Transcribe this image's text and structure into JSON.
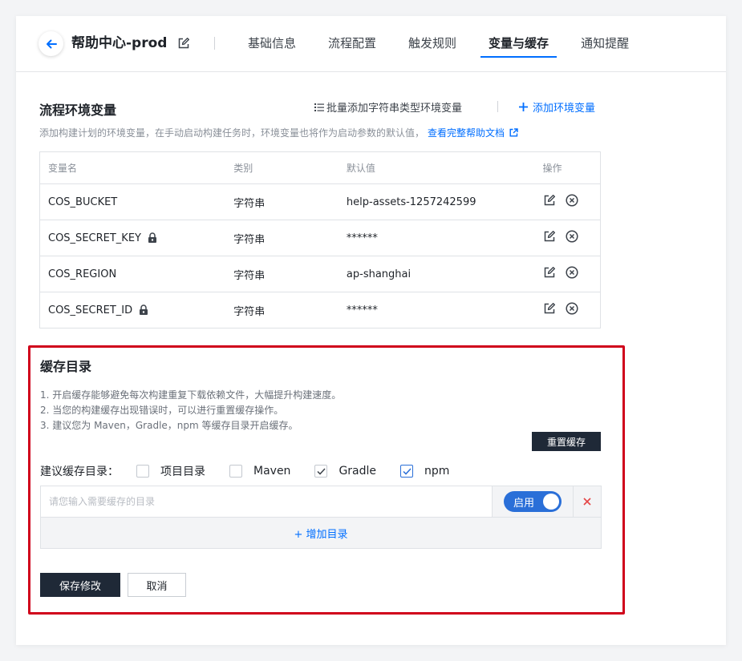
{
  "header": {
    "title": "帮助中心-prod",
    "tabs": [
      {
        "label": "基础信息",
        "active": false
      },
      {
        "label": "流程配置",
        "active": false
      },
      {
        "label": "触发规则",
        "active": false
      },
      {
        "label": "变量与缓存",
        "active": true
      },
      {
        "label": "通知提醒",
        "active": false
      }
    ]
  },
  "env": {
    "title": "流程环境变量",
    "batch_add": "批量添加字符串类型环境变量",
    "add": "添加环境变量",
    "description": "添加构建计划的环境变量，在手动启动构建任务时，环境变量也将作为启动参数的默认值，",
    "help_link": "查看完整帮助文档",
    "columns": {
      "name": "变量名",
      "type": "类别",
      "default": "默认值",
      "ops": "操作"
    },
    "rows": [
      {
        "name": "COS_BUCKET",
        "type": "字符串",
        "default": "help-assets-1257242599",
        "locked": false
      },
      {
        "name": "COS_SECRET_KEY",
        "type": "字符串",
        "default": "******",
        "locked": true
      },
      {
        "name": "COS_REGION",
        "type": "字符串",
        "default": "ap-shanghai",
        "locked": false
      },
      {
        "name": "COS_SECRET_ID",
        "type": "字符串",
        "default": "******",
        "locked": true
      }
    ]
  },
  "cache": {
    "title": "缓存目录",
    "tips": [
      "1. 开启缓存能够避免每次构建重复下载依赖文件，大幅提升构建速度。",
      "2. 当您的构建缓存出现错误时，可以进行重置缓存操作。",
      "3. 建议您为 Maven，Gradle，npm 等缓存目录开启缓存。"
    ],
    "reset": "重置缓存",
    "suggest_label": "建议缓存目录：",
    "options": [
      {
        "label": "项目目录",
        "checked": false
      },
      {
        "label": "Maven",
        "checked": false
      },
      {
        "label": "Gradle",
        "checked": true
      },
      {
        "label": "npm",
        "checked": true
      }
    ],
    "dir_input": {
      "value": "",
      "placeholder": "请您输入需要缓存的目录"
    },
    "toggle_label": "启用",
    "add_dir": "+ 增加目录"
  },
  "actions": {
    "save": "保存修改",
    "cancel": "取消"
  },
  "colors": {
    "accent": "#006eff",
    "dark_button": "#1f2937",
    "highlight_border": "#d0021b"
  }
}
